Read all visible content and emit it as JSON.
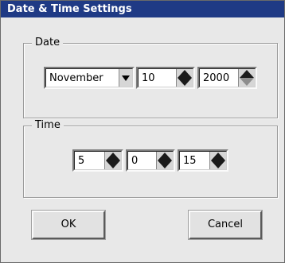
{
  "window": {
    "title": "Date & Time Settings"
  },
  "date": {
    "label": "Date",
    "month": "November",
    "day": "10",
    "year": "2000"
  },
  "time": {
    "label": "Time",
    "hour": "5",
    "minute": "0",
    "second": "15"
  },
  "buttons": {
    "ok": "OK",
    "cancel": "Cancel"
  },
  "colors": {
    "titlebar": "#1f3a85",
    "window_bg": "#e8e8e8"
  },
  "icons": [
    "spin-up-icon",
    "spin-down-icon",
    "dropdown-arrow-icon"
  ]
}
